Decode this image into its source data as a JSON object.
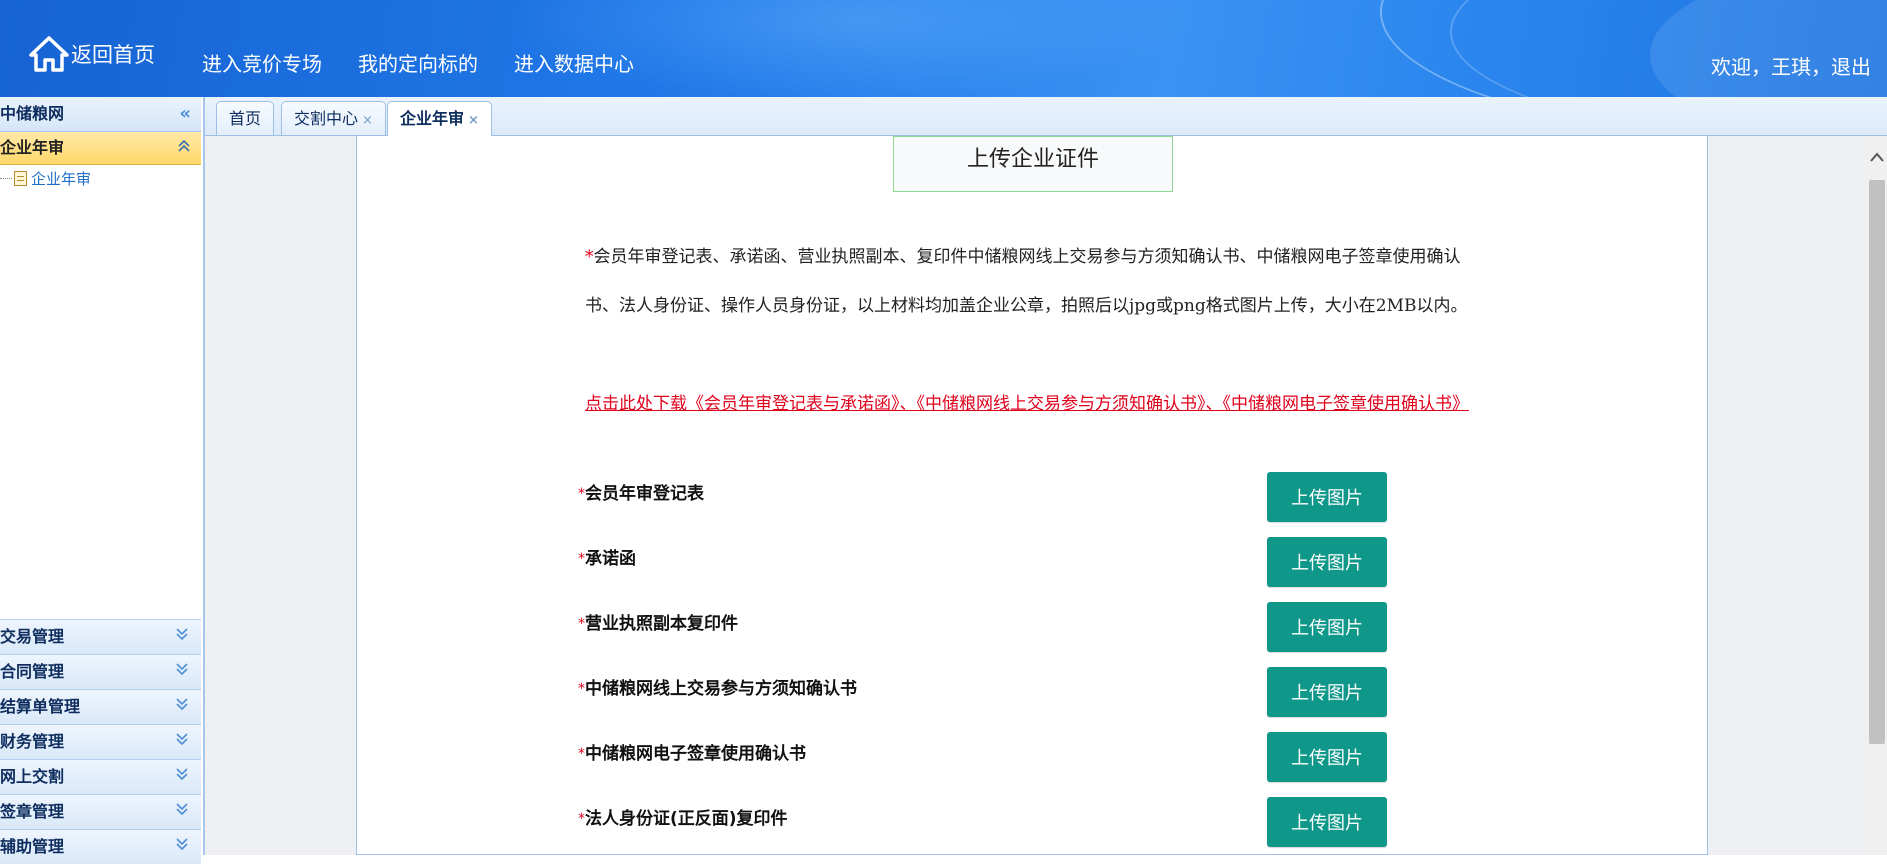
{
  "header": {
    "home_label": "返回首页",
    "home_icon": "house-icon",
    "nav": [
      "进入竞价专场",
      "我的定向标的",
      "进入数据中心"
    ],
    "welcome_text": "欢迎，王琪，退出"
  },
  "sidebar": {
    "title": "中储粮网",
    "collapse_icon": "double-chevron-left-icon",
    "active_group": "企业年审",
    "tree_item": "企业年审",
    "menu": [
      "交易管理",
      "合同管理",
      "结算单管理",
      "财务管理",
      "网上交割",
      "签章管理",
      "辅助管理"
    ]
  },
  "tabs": [
    {
      "label": "首页",
      "closable": false
    },
    {
      "label": "交割中心",
      "closable": true
    },
    {
      "label": "企业年审",
      "closable": true,
      "active": true
    }
  ],
  "tab_close_glyph": "×",
  "main": {
    "title": "上传企业证件",
    "notice_star": "*",
    "notice": "会员年审登记表、承诺函、营业执照副本、复印件中储粮网线上交易参与方须知确认书、中储粮网电子签章使用确认书、法人身份证、操作人员身份证，以上材料均加盖企业公章，拍照后以jpg或png格式图片上传，大小在2MB以内。",
    "download_link": "点击此处下载《会员年审登记表与承诺函》、《中储粮网线上交易参与方须知确认书》、《中储粮网电子签章使用确认书》",
    "upload_button_label": "上传图片",
    "required_star": "*",
    "documents": [
      "会员年审登记表",
      "承诺函",
      "营业执照副本复印件",
      "中储粮网线上交易参与方须知确认书",
      "中储粮网电子签章使用确认书",
      "法人身份证(正反面)复印件"
    ]
  },
  "colors": {
    "banner": "#1e74e0",
    "upload_button": "#0f978a",
    "required": "#e0001b",
    "active_menu": "#ffd86a"
  }
}
